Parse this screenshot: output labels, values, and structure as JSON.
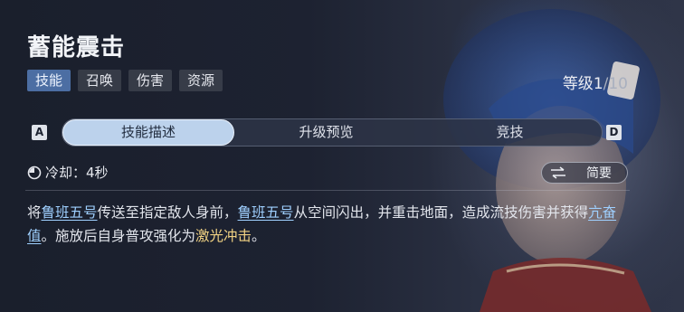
{
  "skill": {
    "title": "蓄能震击",
    "tags": [
      "技能",
      "召唤",
      "伤害",
      "资源"
    ],
    "level_label": "等级",
    "level_current": "1",
    "level_max": "/10"
  },
  "keys": {
    "left": "A",
    "right": "D"
  },
  "tabs": [
    "技能描述",
    "升级预览",
    "竞技"
  ],
  "cooldown": {
    "text": "冷却：4秒"
  },
  "toggle": {
    "label": "简要"
  },
  "description": {
    "t1": "将",
    "link1": "鲁班五号",
    "t2": "传送至指定敌人身前，",
    "link2": "鲁班五号",
    "t3": "从空间闪出，并重击地面，造成流技伤害并获得",
    "link3": "亢奋值",
    "t4": "。施放后自身普攻强化为",
    "highlight": "激光冲击",
    "t5": "。"
  },
  "colors": {
    "active_tag": "#4c6ea3",
    "active_tab": "#bcd2ec",
    "link": "#9fd0ff",
    "highlight": "#f1d283"
  }
}
